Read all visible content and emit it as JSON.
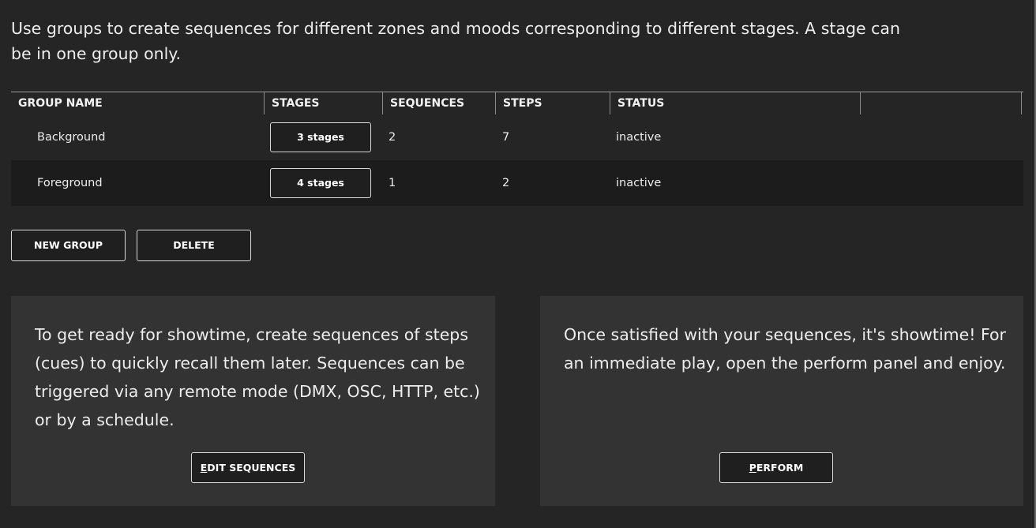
{
  "intro_text": "Use groups to create sequences for different zones and moods corresponding to different stages. A stage can be in one group only.",
  "table": {
    "headers": [
      "GROUP NAME",
      "STAGES",
      "SEQUENCES",
      "STEPS",
      "STATUS",
      ""
    ],
    "rows": [
      {
        "name": "Background",
        "stages": "3 stages",
        "sequences": "2",
        "steps": "7",
        "status": "inactive"
      },
      {
        "name": "Foreground",
        "stages": "4 stages",
        "sequences": "1",
        "steps": "2",
        "status": "inactive"
      }
    ]
  },
  "actions": {
    "new_group": "NEW GROUP",
    "delete": "DELETE"
  },
  "panels": {
    "sequences": {
      "text": "To get ready for showtime, create sequences of steps (cues) to quickly recall them later. Sequences can be triggered via any remote mode (DMX, OSC, HTTP, etc.) or by a schedule.",
      "button": "EDIT SEQUENCES"
    },
    "perform": {
      "text": "Once satisfied with your sequences, it's showtime! For an immediate play, open the perform panel and enjoy.",
      "button": "PERFORM"
    }
  }
}
